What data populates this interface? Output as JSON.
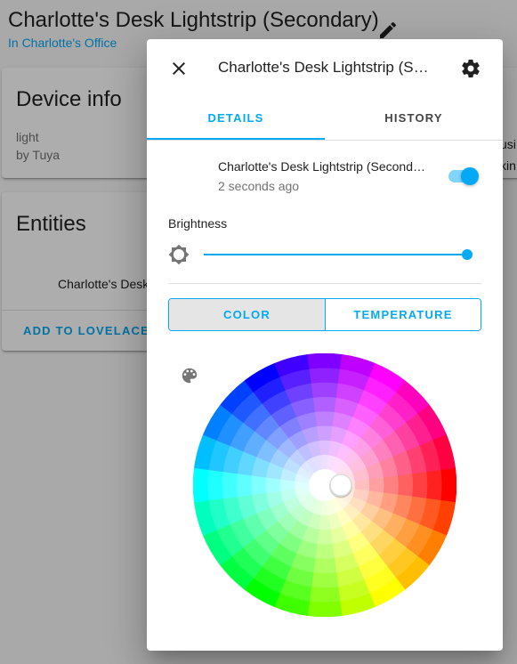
{
  "page": {
    "title": "Charlotte's Desk Lightstrip (Secondary)",
    "subtitle": "In Charlotte's Office",
    "edit_icon": "pencil-icon"
  },
  "device_info_card": {
    "title": "Device info",
    "model": "light",
    "manufacturer": "by Tuya"
  },
  "entities_card": {
    "title": "Entities",
    "entity": "Charlotte's Desk Lightstrip (Secondary)",
    "action": "ADD TO LOVELACE"
  },
  "right_card": {
    "line1": "usi",
    "line2": "kin"
  },
  "dialog": {
    "close_icon": "close-icon",
    "title": "Charlotte's Desk Lightstrip (Secondary)",
    "settings_icon": "gear-icon",
    "tabs": [
      {
        "label": "DETAILS",
        "active": true
      },
      {
        "label": "HISTORY",
        "active": false
      }
    ],
    "entity": {
      "name": "Charlotte's Desk Lightstrip (Secondary)",
      "last_changed": "2 seconds ago",
      "state_on": true
    },
    "brightness": {
      "label": "Brightness",
      "icon": "brightness-icon",
      "value_percent": 100
    },
    "mode_buttons": [
      {
        "label": "COLOR",
        "selected": true
      },
      {
        "label": "TEMPERATURE",
        "selected": false
      }
    ],
    "palette_icon": "palette-icon",
    "color_wheel": {
      "hue_segments": 24,
      "saturation_rings": 8,
      "selected_hs": [
        0,
        0
      ]
    }
  },
  "colors": {
    "accent": "#03a9f4",
    "accent_light": "#81d4fa",
    "primary_text": "#212121",
    "secondary_text": "#727272"
  }
}
